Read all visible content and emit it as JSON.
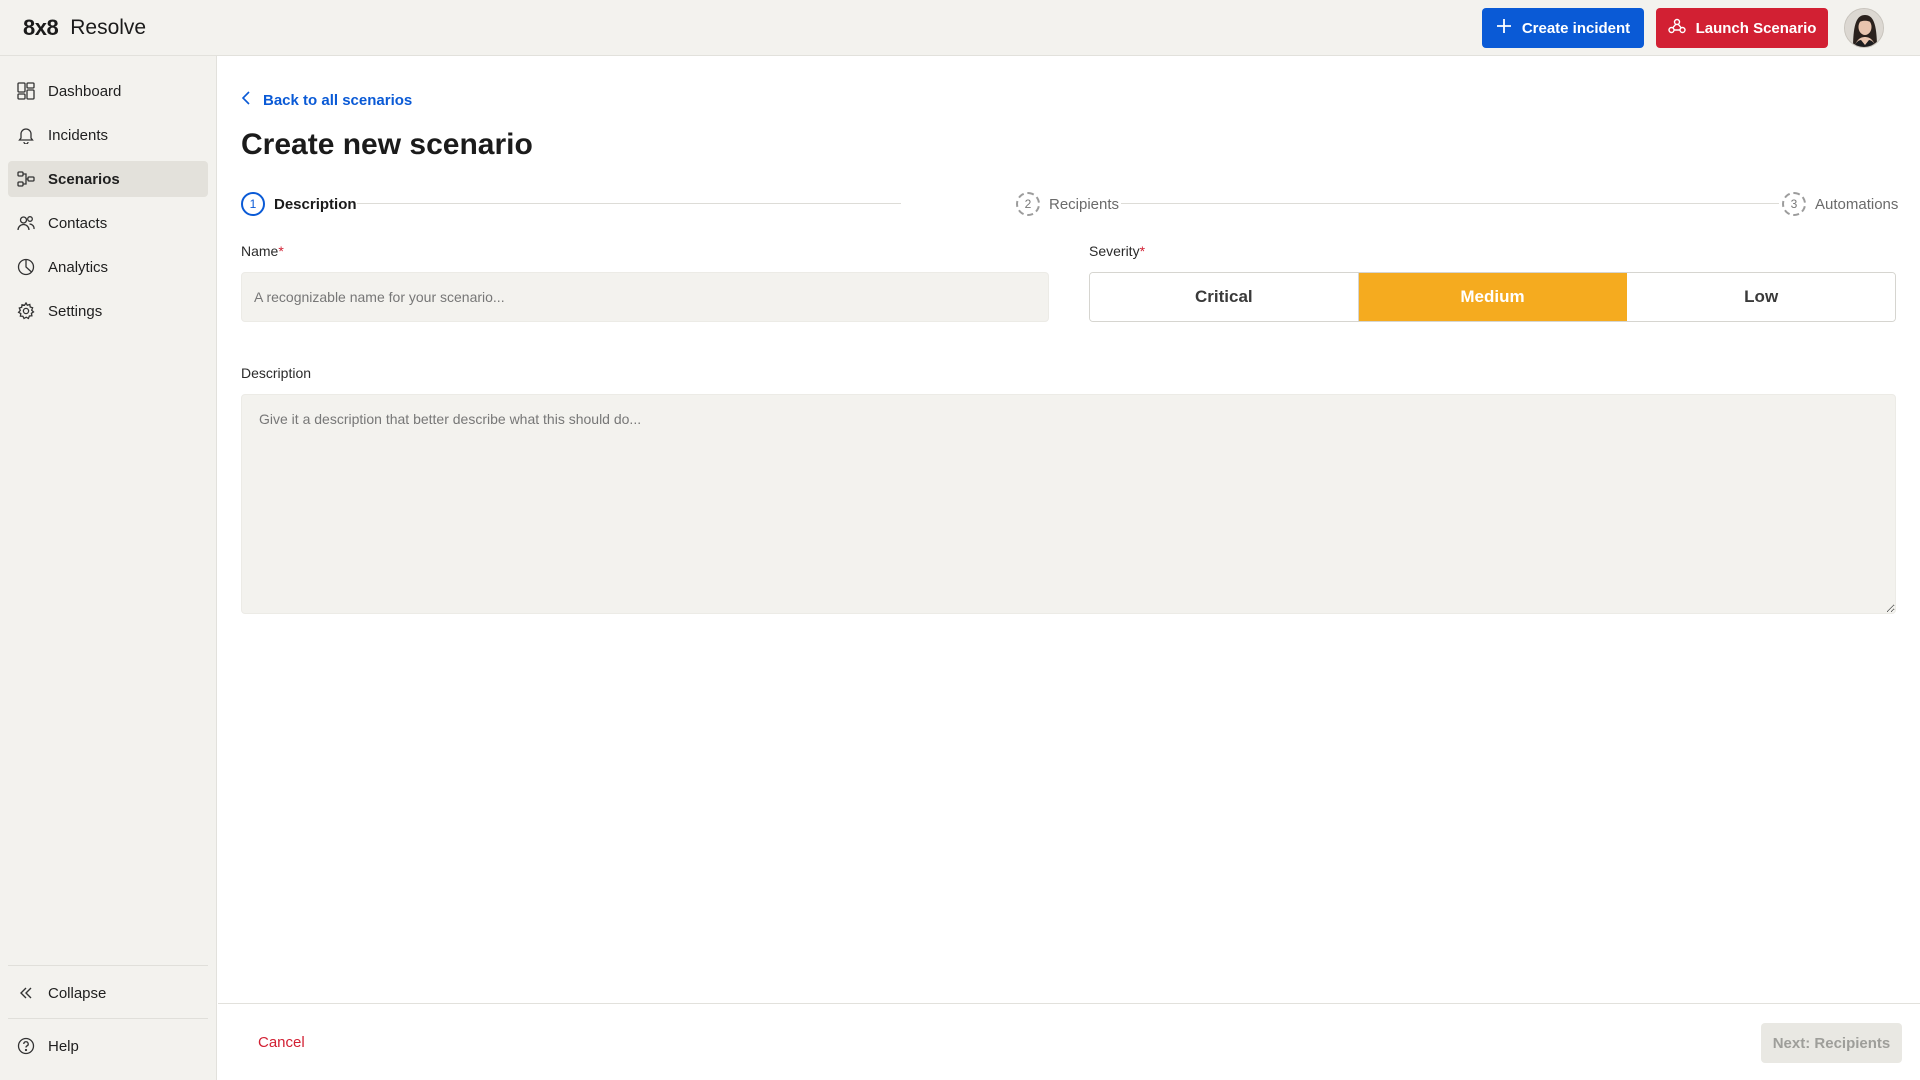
{
  "app": {
    "logo_text": "8x8",
    "name": "Resolve"
  },
  "header": {
    "create_label": "Create incident",
    "launch_label": "Launch Scenario"
  },
  "sidebar": {
    "items": [
      {
        "label": "Dashboard",
        "icon": "dashboard-icon"
      },
      {
        "label": "Incidents",
        "icon": "bell-icon"
      },
      {
        "label": "Scenarios",
        "icon": "scenarios-icon",
        "active": true
      },
      {
        "label": "Contacts",
        "icon": "contacts-icon"
      },
      {
        "label": "Analytics",
        "icon": "analytics-icon"
      },
      {
        "label": "Settings",
        "icon": "gear-icon"
      }
    ],
    "collapse_label": "Collapse",
    "help_label": "Help"
  },
  "main": {
    "back_label": "Back to all scenarios",
    "title": "Create new scenario",
    "steps": [
      {
        "number": "1",
        "label": "Description",
        "state": "current"
      },
      {
        "number": "2",
        "label": "Recipients",
        "state": "upcoming"
      },
      {
        "number": "3",
        "label": "Automations",
        "state": "upcoming"
      }
    ],
    "name_field": {
      "label": "Name",
      "required_mark": "*",
      "placeholder": "A recognizable name for your scenario...",
      "value": ""
    },
    "severity": {
      "label": "Severity",
      "required_mark": "*",
      "options": [
        "Critical",
        "Medium",
        "Low"
      ],
      "selected": "Medium"
    },
    "description_field": {
      "label": "Description",
      "placeholder": "Give it a description that better describe what this should do...",
      "value": ""
    }
  },
  "footer": {
    "cancel_label": "Cancel",
    "next_label": "Next: Recipients"
  },
  "colors": {
    "primary": "#0a5ad6",
    "danger": "#d22033",
    "severity_selected": "#f5ab1f",
    "surface": "#f3f2ee"
  }
}
